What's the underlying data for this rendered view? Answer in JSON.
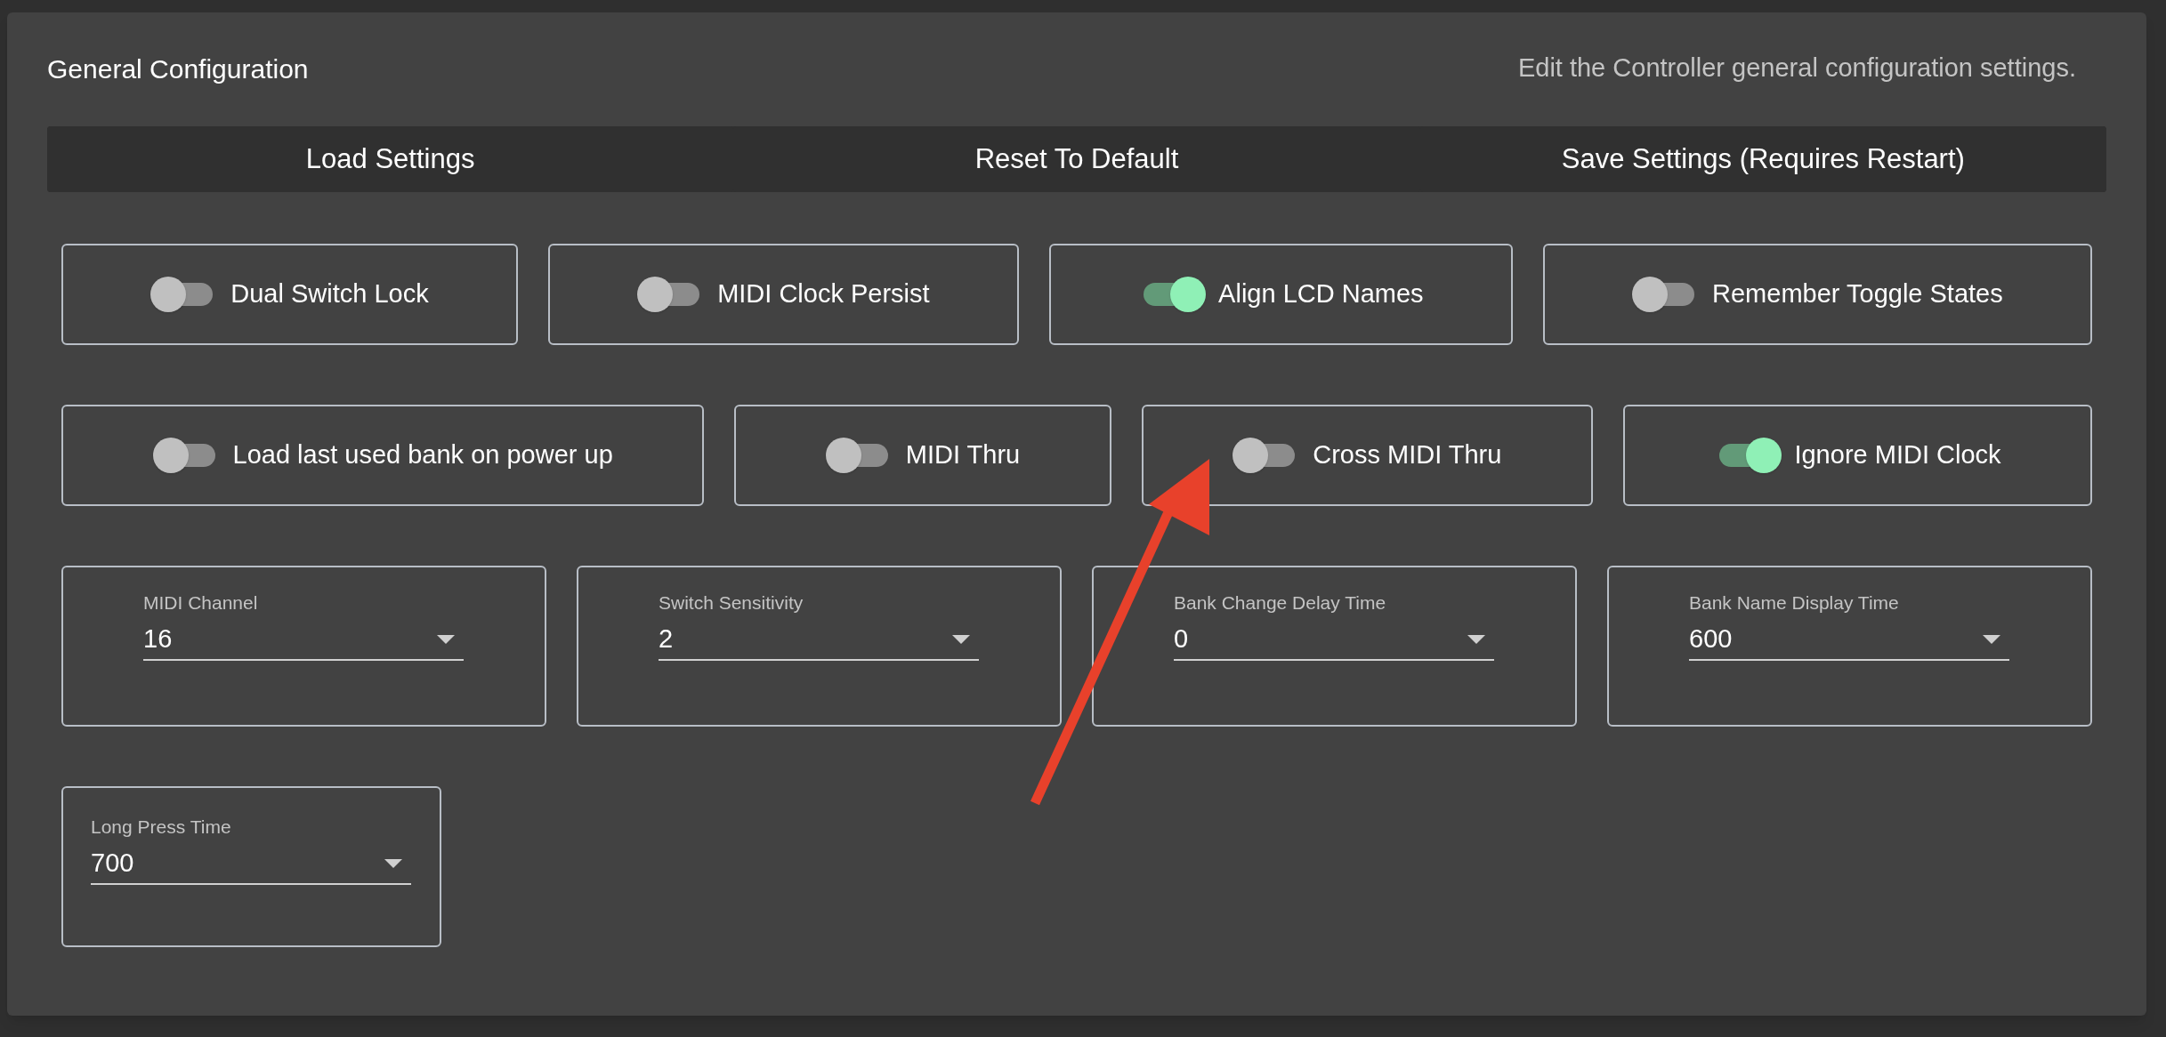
{
  "header": {
    "title": "General Configuration",
    "description": "Edit the Controller general configuration settings."
  },
  "actions": [
    "Load Settings",
    "Reset To Default",
    "Save Settings (Requires Restart)"
  ],
  "toggle_rows": [
    [
      {
        "label": "Dual Switch Lock",
        "on": false
      },
      {
        "label": "MIDI Clock Persist",
        "on": false
      },
      {
        "label": "Align LCD Names",
        "on": true
      },
      {
        "label": "Remember Toggle States",
        "on": false
      }
    ],
    [
      {
        "label": "Load last used bank on power up",
        "on": false
      },
      {
        "label": "MIDI Thru",
        "on": false
      },
      {
        "label": "Cross MIDI Thru",
        "on": false
      },
      {
        "label": "Ignore MIDI Clock",
        "on": true
      }
    ]
  ],
  "select_rows": [
    [
      {
        "label": "MIDI Channel",
        "value": "16"
      },
      {
        "label": "Switch Sensitivity",
        "value": "2"
      },
      {
        "label": "Bank Change Delay Time",
        "value": "0"
      },
      {
        "label": "Bank Name Display Time",
        "value": "600"
      }
    ],
    [
      {
        "label": "Long Press Time",
        "value": "700"
      }
    ]
  ]
}
